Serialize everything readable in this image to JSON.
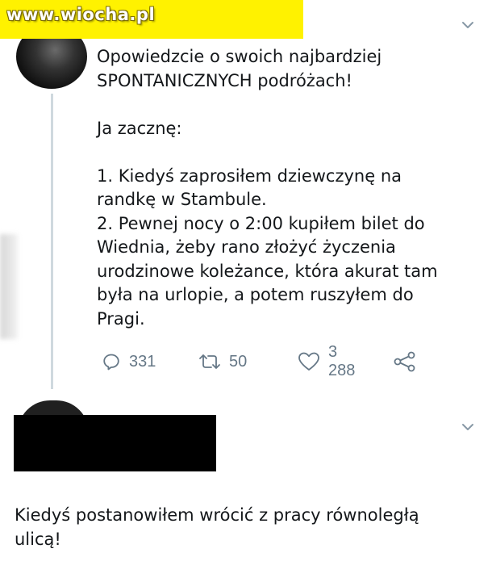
{
  "watermark": {
    "text": "www.wiocha.pl"
  },
  "tweet": {
    "lines": [
      "Opowiedzcie o swoich najbardziej",
      "SPONTANICZNYCH podróżach!",
      "",
      "Ja zacznę:",
      "",
      "1. Kiedyś zaprosiłem dziewczynę na",
      "randkę w Stambule.",
      "2. Pewnej nocy o 2:00 kupiłem bilet do",
      "Wiednia, żeby rano złożyć życzenia",
      "urodzinowe koleżance, która akurat tam",
      "była na urlopie, a potem ruszyłem do",
      "Pragi."
    ],
    "actions": {
      "reply": {
        "icon": "reply-icon",
        "count": "331"
      },
      "retweet": {
        "icon": "retweet-icon",
        "count": "50"
      },
      "like": {
        "icon": "heart-icon",
        "count": "3 288"
      },
      "share": {
        "icon": "share-icon"
      }
    }
  },
  "reply": {
    "lines": [
      "Kiedyś postanowiłem wrócić z pracy równoległą",
      "ulicą!"
    ]
  },
  "colors": {
    "text": "#14171a",
    "muted": "#657786",
    "thread_line": "#cfd9de",
    "watermark_bg": "#fff200"
  }
}
